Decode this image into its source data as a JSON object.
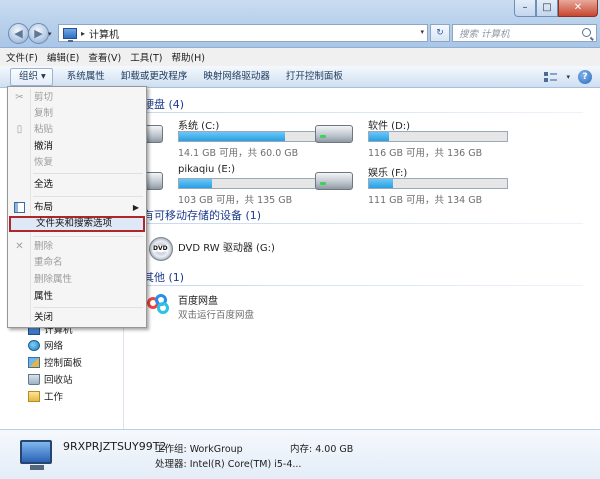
{
  "window": {
    "controls": {
      "minimize": "–",
      "maximize": "□",
      "close": "✕"
    }
  },
  "nav": {
    "back_glyph": "◀",
    "forward_glyph": "▶",
    "dropdown_glyph": "▾"
  },
  "address": {
    "separator": "▸",
    "path": "计算机",
    "dropdown_glyph": "▾",
    "refresh_glyph": "↻"
  },
  "search": {
    "placeholder": "搜索 计算机"
  },
  "menubar": {
    "items": [
      "文件(F)",
      "编辑(E)",
      "查看(V)",
      "工具(T)",
      "帮助(H)"
    ]
  },
  "commandbar": {
    "organize": "组织 ▾",
    "items": [
      "系统属性",
      "卸载或更改程序",
      "映射网络驱动器",
      "打开控制面板"
    ],
    "view_dropdown": "▾",
    "help": "?"
  },
  "sidebar": {
    "items": [
      {
        "label": "计算机",
        "icon": "computer-icon"
      },
      {
        "label": "网络",
        "icon": "network-icon"
      },
      {
        "label": "控制面板",
        "icon": "control-panel-icon"
      },
      {
        "label": "回收站",
        "icon": "recycle-bin-icon"
      },
      {
        "label": "工作",
        "icon": "folder-icon"
      }
    ]
  },
  "groups": {
    "hard_disks": "硬盘 (4)",
    "removable": "有可移动存储的设备 (1)",
    "other": "其他 (1)"
  },
  "drives": [
    {
      "name": "系统 (C:)",
      "free": "14.1 GB 可用，共 60.0 GB",
      "used_fraction": 0.765
    },
    {
      "name": "软件 (D:)",
      "free": "116 GB 可用，共 136 GB",
      "used_fraction": 0.147
    },
    {
      "name": "pikaqiu (E:)",
      "free": "103 GB 可用，共 135 GB",
      "used_fraction": 0.237
    },
    {
      "name": "娱乐 (F:)",
      "free": "111 GB 可用，共 134 GB",
      "used_fraction": 0.172
    }
  ],
  "dvd": {
    "name": "DVD RW 驱动器 (G:)",
    "badge": "DVD"
  },
  "other_item": {
    "name": "百度网盘",
    "desc": "双击运行百度网盘"
  },
  "details": {
    "computer_name": "9RXPRJZTSUY99T2",
    "workgroup": "工作组: WorkGroup",
    "memory": "内存: 4.00 GB",
    "processor": "处理器: Intel(R) Core(TM) i5-4..."
  },
  "organize_menu": {
    "items": [
      {
        "label": "剪切",
        "disabled": true,
        "icon": "✂"
      },
      {
        "label": "复制",
        "disabled": true,
        "icon": ""
      },
      {
        "label": "粘贴",
        "disabled": true,
        "icon": "▯"
      },
      {
        "label": "撤消",
        "disabled": false,
        "icon": ""
      },
      {
        "label": "恢复",
        "disabled": true,
        "icon": ""
      },
      {
        "label": "全选",
        "disabled": false,
        "icon": ""
      },
      {
        "label": "布局",
        "disabled": false,
        "icon": "",
        "submenu": "▶"
      },
      {
        "label": "文件夹和搜索选项",
        "disabled": false,
        "icon": "",
        "selected": true
      },
      {
        "label": "删除",
        "disabled": true,
        "icon": "✕"
      },
      {
        "label": "重命名",
        "disabled": true,
        "icon": ""
      },
      {
        "label": "删除属性",
        "disabled": true,
        "icon": ""
      },
      {
        "label": "属性",
        "disabled": false,
        "icon": ""
      },
      {
        "label": "关闭",
        "disabled": false,
        "icon": ""
      }
    ]
  },
  "colors": {
    "highlight_border": "#b0262d",
    "drive_bar_fill": "#27a0e5",
    "group_header": "#1e3b8c"
  }
}
